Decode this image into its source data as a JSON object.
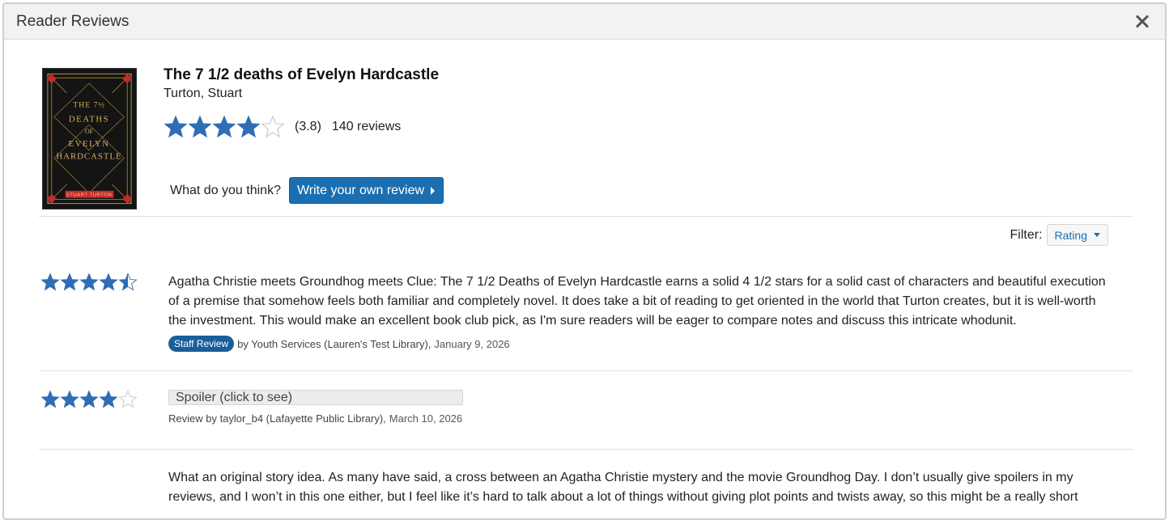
{
  "dialog": {
    "title": "Reader Reviews"
  },
  "book": {
    "title": "The 7 1/2 deaths of Evelyn Hardcastle",
    "author": "Turton, Stuart",
    "rating": 3.8,
    "rating_text": "(3.8)",
    "review_count": "140 reviews",
    "cover_lines": [
      "THE 7½",
      "DEATHS",
      "OF",
      "EVELYN",
      "HARDCASTLE"
    ],
    "cover_author": "STUART TURTON"
  },
  "cta": {
    "prompt": "What do you think?",
    "button_label": "Write your own review"
  },
  "filter": {
    "label": "Filter:",
    "selected": "Rating"
  },
  "reviews": [
    {
      "stars": 4.5,
      "text": "Agatha Christie meets Groundhog meets Clue: The 7 1/2 Deaths of Evelyn Hardcastle earns a solid 4 1/2 stars for a solid cast of characters and beautiful execution of a premise that somehow feels both familiar and completely novel. It does take a bit of reading to get oriented in the world that Turton creates, but it is well-worth the investment. This would make an excellent book club pick, as I'm sure readers will be eager to compare notes and discuss this intricate whodunit.",
      "badge": "Staff Review",
      "byline": "by Youth Services (Lauren's Test Library),",
      "date": "January 9, 2026"
    },
    {
      "stars": 4,
      "spoiler_label": "Spoiler (click to see)",
      "byline": "Review by taylor_b4 (Lafayette Public Library),",
      "date": "March 10, 2026"
    },
    {
      "text": "What an original story idea. As many have said, a cross between an Agatha Christie mystery and the movie Groundhog Day. I don’t usually give spoilers in my reviews, and I won’t in this one either, but I feel like it’s hard to talk about a lot of things without giving plot points and twists away, so this might be a really short"
    }
  ],
  "colors": {
    "star_fill": "#2f6eb5",
    "star_empty": "#c8c8c8",
    "button_bg": "#1b6fb1",
    "badge_bg": "#1b5e9a",
    "link": "#1b6fb1"
  }
}
